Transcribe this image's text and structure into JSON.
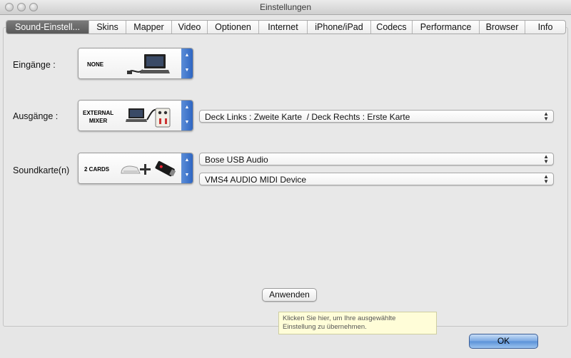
{
  "window": {
    "title": "Einstellungen"
  },
  "tabs": [
    {
      "label": "Sound-Einstell...",
      "active": true
    },
    {
      "label": "Skins"
    },
    {
      "label": "Mapper"
    },
    {
      "label": "Video"
    },
    {
      "label": "Optionen"
    },
    {
      "label": "Internet"
    },
    {
      "label": "iPhone/iPad"
    },
    {
      "label": "Codecs"
    },
    {
      "label": "Performance"
    },
    {
      "label": "Browser"
    },
    {
      "label": "Info"
    }
  ],
  "inputs": {
    "label": "Eingänge :",
    "selector_text": "NONE"
  },
  "outputs": {
    "label": "Ausgänge :",
    "selector_text_line1": "EXTERNAL",
    "selector_text_line2": "MIXER",
    "routing_value": "Deck Links : Zweite Karte  / Deck Rechts : Erste Karte"
  },
  "soundcards": {
    "label": "Soundkarte(n)",
    "selector_text": "2 CARDS",
    "card1_value": "Bose USB Audio",
    "card2_value": "VMS4 AUDIO MIDI Device"
  },
  "apply_button": "Anwenden",
  "tooltip": {
    "line1": "Klicken Sie hier, um Ihre ausgewählte",
    "line2": "Einstellung zu übernehmen."
  },
  "ok_button": "OK",
  "icons": {
    "stepper_up": "▲",
    "stepper_down": "▼",
    "popup_arrows": "⇕"
  },
  "colors": {
    "accent_blue": "#3f78cf",
    "tooltip_bg": "#fffdd8",
    "active_tab": "#6a6a6a"
  }
}
